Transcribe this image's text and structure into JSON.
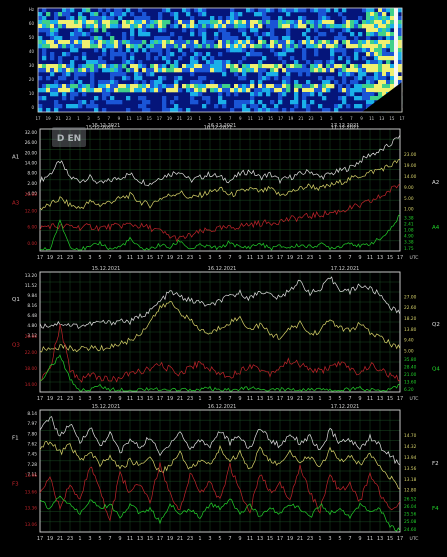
{
  "colors": {
    "background": "#000000",
    "grid": "#1f5a2a",
    "frame": "#d8d8d8",
    "date_text": "#d0d0d0",
    "white_series": "#e0e0e0",
    "yellow_series": "#d8d36a",
    "red_series": "#c0242a",
    "green_series": "#22d02a"
  },
  "watermark": "D EN",
  "spectrogram": {
    "date_labels": [
      "15.12.2021",
      "16.12.2021",
      "17.12.2021"
    ],
    "y_labels": [
      "Hz",
      "60",
      "50",
      "40",
      "30",
      "20",
      "10",
      "0"
    ],
    "x_ticks": [
      "17",
      "19",
      "21",
      "23",
      "1",
      "3",
      "5",
      "7",
      "9",
      "11",
      "13",
      "15",
      "17",
      "19",
      "21",
      "23",
      "1",
      "3",
      "5",
      "7",
      "9",
      "11",
      "13",
      "15",
      "17",
      "19",
      "21",
      "23",
      "1",
      "3",
      "5",
      "7",
      "9",
      "11",
      "13",
      "15",
      "17"
    ]
  },
  "chart_data": [
    {
      "type": "line",
      "panel": "A",
      "dates": [
        "15.12.2021",
        "16.12.2021",
        "17.12.2021"
      ],
      "x_ticks": [
        "17",
        "19",
        "21",
        "23",
        "1",
        "3",
        "5",
        "7",
        "9",
        "11",
        "13",
        "15",
        "17",
        "19",
        "21",
        "23",
        "1",
        "3",
        "5",
        "7",
        "9",
        "11",
        "13",
        "15",
        "17",
        "19",
        "21",
        "23",
        "1",
        "3",
        "5",
        "7",
        "9",
        "11",
        "13",
        "15",
        "17"
      ],
      "x_unit": "UTC",
      "left_axis": [
        "32.00",
        "26.00",
        "20.00",
        "14.00",
        "8.00",
        "2.00",
        "-4.00"
      ],
      "left_axis_red": [
        "20.00",
        "12.00",
        "6.00",
        "0.00"
      ],
      "right_axis": [
        "23.00",
        "19.00",
        "14.00",
        "9.00",
        "5.00",
        "1.00"
      ],
      "right_axis_green": [
        "3.38",
        "2.41",
        "1.08",
        "4.90",
        "3.38",
        "1.75"
      ],
      "labels": {
        "left_white": "A1",
        "left_red": "A3",
        "right_white": "A2",
        "right_green": "A4"
      },
      "series": [
        {
          "values": [
            22,
            24,
            28,
            23,
            22,
            23,
            21,
            22,
            23,
            24,
            22,
            21,
            23,
            24,
            25,
            22,
            23,
            24,
            23,
            22,
            24,
            25,
            23,
            24,
            22,
            23,
            24,
            25,
            23,
            24,
            25,
            26,
            28,
            30,
            31,
            33,
            36
          ]
        },
        {
          "values": [
            12,
            13,
            15,
            13,
            12,
            14,
            13,
            14,
            15,
            16,
            14,
            13,
            15,
            16,
            17,
            15,
            16,
            17,
            18,
            16,
            17,
            18,
            17,
            18,
            16,
            17,
            18,
            19,
            18,
            19,
            20,
            21,
            22,
            23,
            24,
            25,
            27
          ]
        },
        {
          "values": [
            6,
            6.5,
            6.2,
            6.4,
            6.1,
            6.3,
            6.0,
            6.2,
            6.5,
            6.8,
            6.4,
            6.0,
            5.2,
            4.0,
            3.5,
            4.2,
            5.0,
            5.5,
            5.8,
            6.0,
            6.4,
            6.8,
            7.0,
            7.2,
            7.5,
            8.0,
            8.3,
            8.7,
            9.0,
            9.4,
            9.8,
            10.5,
            11.0,
            12.0,
            13.0,
            14.5,
            16.0
          ]
        },
        {
          "values": [
            0.5,
            0.6,
            4.5,
            1.0,
            0.6,
            0.8,
            1.5,
            0.6,
            0.9,
            2.0,
            0.7,
            0.6,
            1.2,
            0.8,
            1.8,
            0.6,
            1.1,
            0.9,
            0.7,
            1.6,
            0.8,
            0.9,
            1.4,
            0.7,
            1.0,
            0.8,
            1.2,
            0.9,
            1.3,
            0.8,
            1.0,
            1.6,
            0.9,
            1.4,
            2.0,
            3.2,
            5.5
          ]
        }
      ]
    },
    {
      "type": "line",
      "panel": "Q",
      "dates": [
        "15.12.2021",
        "16.12.2021",
        "17.12.2021"
      ],
      "x_ticks": [
        "17",
        "19",
        "21",
        "23",
        "1",
        "3",
        "5",
        "7",
        "9",
        "11",
        "13",
        "15",
        "17",
        "19",
        "21",
        "23",
        "1",
        "3",
        "5",
        "7",
        "9",
        "11",
        "13",
        "15",
        "17",
        "19",
        "21",
        "23",
        "1",
        "3",
        "5",
        "7",
        "9",
        "11",
        "13",
        "15",
        "17"
      ],
      "x_unit": "UTC",
      "left_axis": [
        "13.20",
        "11.52",
        "9.84",
        "8.16",
        "6.48",
        "4.80",
        "3.12"
      ],
      "left_axis_red": [
        "26.00",
        "22.00",
        "18.00",
        "14.00"
      ],
      "right_axis": [
        "27.00",
        "22.60",
        "18.20",
        "13.80",
        "9.40",
        "5.00"
      ],
      "right_axis_green": [
        "35.80",
        "28.40",
        "21.00",
        "13.60",
        "6.20"
      ],
      "labels": {
        "left_white": "Q1",
        "left_red": "Q3",
        "right_white": "Q2",
        "right_green": "Q4"
      },
      "series": [
        {
          "values": [
            6.0,
            6.1,
            6.3,
            6.1,
            6.0,
            6.2,
            6.4,
            6.3,
            6.6,
            6.4,
            7.0,
            7.5,
            8.5,
            9.5,
            9.0,
            8.6,
            8.4,
            8.0,
            8.6,
            9.0,
            9.4,
            8.8,
            9.6,
            9.2,
            8.8,
            9.8,
            10.5,
            9.4,
            9.6,
            10.9,
            9.8,
            9.5,
            10.2,
            9.8,
            9.2,
            8.0,
            7.2
          ]
        },
        {
          "values": [
            14,
            14.2,
            14.5,
            14.3,
            14.1,
            14.4,
            14.2,
            14.5,
            15.0,
            15.5,
            16.5,
            18.5,
            20.5,
            21.5,
            20.0,
            18.6,
            17.2,
            16.5,
            17.5,
            18.4,
            19.0,
            17.2,
            18.0,
            16.5,
            16.0,
            17.2,
            18.2,
            16.4,
            17.0,
            18.8,
            17.4,
            17.0,
            18.1,
            16.6,
            16.1,
            15.0,
            14.2
          ]
        },
        {
          "values": [
            20.5,
            21,
            23,
            21,
            20.5,
            20.8,
            20.6,
            20.5,
            20.6,
            20.8,
            20.9,
            21.0,
            21.2,
            21.0,
            20.8,
            21.1,
            21.3,
            21.0,
            20.8,
            20.7,
            20.9,
            21.2,
            21.0,
            20.8,
            21.1,
            21.4,
            21.2,
            21.0,
            20.9,
            21.1,
            21.3,
            21.0,
            20.8,
            21.2,
            21.0,
            20.7,
            20.5
          ]
        },
        {
          "values": [
            9.5,
            12,
            14,
            10,
            8.0,
            8.2,
            9.0,
            8.1,
            8.3,
            8.0,
            8.2,
            8.5,
            8.1,
            8.0,
            8.3,
            8.1,
            8.2,
            8.4,
            8.0,
            8.1,
            8.3,
            8.5,
            8.1,
            8.0,
            8.2,
            8.3,
            8.1,
            8.4,
            8.2,
            8.0,
            8.1,
            8.3,
            8.5,
            8.1,
            8.0,
            8.4,
            9.0
          ]
        }
      ]
    },
    {
      "type": "line",
      "panel": "F",
      "dates": [
        "15.12.2021",
        "16.12.2021",
        "17.12.2021"
      ],
      "x_ticks": [
        "17",
        "19",
        "21",
        "23",
        "1",
        "3",
        "5",
        "7",
        "9",
        "11",
        "13",
        "15",
        "17",
        "19",
        "21",
        "23",
        "1",
        "3",
        "5",
        "7",
        "9",
        "11",
        "13",
        "15",
        "17",
        "19",
        "21",
        "23",
        "1",
        "3",
        "5",
        "7",
        "9",
        "11",
        "13",
        "15",
        "17"
      ],
      "x_unit": "UTC",
      "left_axis": [
        "8.14",
        "7.97",
        "7.80",
        "7.62",
        "7.45",
        "7.28",
        "7.11"
      ],
      "left_axis_red": [
        "13.96",
        "13.66",
        "13.36",
        "13.06"
      ],
      "right_axis": [
        "14.70",
        "14.32",
        "13.94",
        "13.56",
        "13.18",
        "12.80"
      ],
      "right_axis_green": [
        "26.52",
        "26.04",
        "25.56",
        "25.08",
        "24.60"
      ],
      "labels": {
        "left_white": "F1",
        "left_red": "F3",
        "right_white": "F2",
        "right_green": "F4"
      },
      "series": [
        {
          "values": [
            7.95,
            8.05,
            7.92,
            8.0,
            7.88,
            7.98,
            7.86,
            7.94,
            7.82,
            7.9,
            7.85,
            7.92,
            7.8,
            7.88,
            7.95,
            7.84,
            7.9,
            7.86,
            7.96,
            7.88,
            7.92,
            7.84,
            7.98,
            7.9,
            7.86,
            7.94,
            7.88,
            7.92,
            7.82,
            7.96,
            7.88,
            7.9,
            7.84,
            7.92,
            7.86,
            7.8,
            7.74
          ]
        },
        {
          "values": [
            14.3,
            14.5,
            14.2,
            14.4,
            14.0,
            14.2,
            13.9,
            14.1,
            13.8,
            14.0,
            13.9,
            14.1,
            13.7,
            13.9,
            14.2,
            13.8,
            14.0,
            13.9,
            14.3,
            14.0,
            14.2,
            13.8,
            14.3,
            14.0,
            13.9,
            14.2,
            14.0,
            14.1,
            13.8,
            14.3,
            14.0,
            14.1,
            13.9,
            14.2,
            13.9,
            13.6,
            13.3
          ]
        },
        {
          "values": [
            13.6,
            13.62,
            13.58,
            13.61,
            13.59,
            13.63,
            13.6,
            13.57,
            13.62,
            13.6,
            13.61,
            13.59,
            13.63,
            13.6,
            13.58,
            13.62,
            13.6,
            13.61,
            13.59,
            13.63,
            13.6,
            13.58,
            13.62,
            13.6,
            13.61,
            13.59,
            13.63,
            13.6,
            13.58,
            13.62,
            13.6,
            13.61,
            13.59,
            13.62,
            13.6,
            13.58,
            13.59
          ]
        },
        {
          "values": [
            25.4,
            25.2,
            25.5,
            25.3,
            25.1,
            25.4,
            25.2,
            25.3,
            25.0,
            25.3,
            25.1,
            25.2,
            24.9,
            25.3,
            25.1,
            25.2,
            25.0,
            25.3,
            25.2,
            25.4,
            25.1,
            25.3,
            25.0,
            25.2,
            25.1,
            25.3,
            25.2,
            25.0,
            25.3,
            25.1,
            25.2,
            25.0,
            25.3,
            25.1,
            25.2,
            24.8,
            24.7
          ]
        }
      ]
    }
  ]
}
